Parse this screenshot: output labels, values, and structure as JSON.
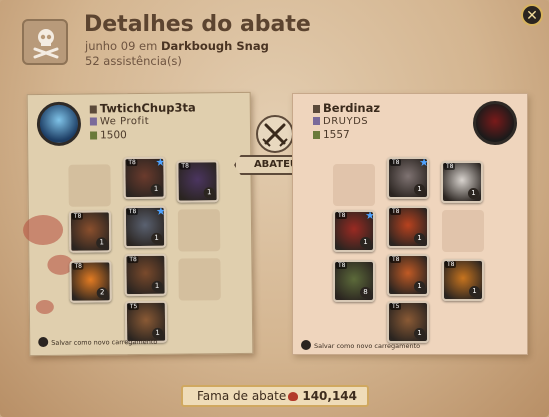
{
  "header": {
    "title": "Detalhes do abate",
    "date": "junho 09 em",
    "location": "Darkbough Snag",
    "assists": "52 assistência(s)"
  },
  "killer": {
    "name": "TwtichChup3ta",
    "guild": "We Profit",
    "ip": "1500",
    "save_label": "Salvar como novo carregamento",
    "items": [
      {
        "name": "cape",
        "tier": "T8",
        "quality": "1",
        "color": "#6b3b2d",
        "star": true
      },
      {
        "name": "bag",
        "tier": "T8",
        "quality": "1",
        "color": "#4b3560",
        "star": false
      },
      {
        "name": "weapon",
        "tier": "T8",
        "quality": "1",
        "color": "#8a4f2d",
        "star": false
      },
      {
        "name": "armor",
        "tier": "T8",
        "quality": "1",
        "color": "#5a6170",
        "star": true
      },
      {
        "name": "potion",
        "tier": "T8",
        "quality": "2",
        "color": "#e27b22",
        "star": false
      },
      {
        "name": "boots",
        "tier": "T8",
        "quality": "1",
        "color": "#7a4a2c",
        "star": false
      },
      {
        "name": "mount",
        "tier": "T5",
        "quality": "1",
        "color": "#8a5a35",
        "star": false
      }
    ]
  },
  "victim": {
    "name": "Berdinaz",
    "guild": "DRUYDS",
    "ip": "1557",
    "save_label": "Salvar como novo carregamento",
    "items": [
      {
        "name": "helmet",
        "tier": "T8",
        "quality": "1",
        "color": "#7f7372",
        "star": true
      },
      {
        "name": "bag",
        "tier": "T8",
        "quality": "1",
        "color": "#d8d3ce",
        "star": false
      },
      {
        "name": "weapon",
        "tier": "T8",
        "quality": "1",
        "color": "#9a2a22",
        "star": true
      },
      {
        "name": "armor",
        "tier": "T8",
        "quality": "1",
        "color": "#b8421f",
        "star": false
      },
      {
        "name": "potion",
        "tier": "T8",
        "quality": "8",
        "color": "#5c6a3a",
        "star": false
      },
      {
        "name": "boots",
        "tier": "T8",
        "quality": "1",
        "color": "#c05a25",
        "star": false
      },
      {
        "name": "food",
        "tier": "T8",
        "quality": "1",
        "color": "#c7741f",
        "star": false
      },
      {
        "name": "mount",
        "tier": "T5",
        "quality": "1",
        "color": "#8a5a35",
        "star": false
      }
    ]
  },
  "kill_label": "ABATEU",
  "fame": {
    "label": "Fama de abate",
    "value": "140,144"
  },
  "colors": {
    "title": "#5c4430",
    "accent": "#d0a860",
    "blood": "#b44c3c"
  }
}
